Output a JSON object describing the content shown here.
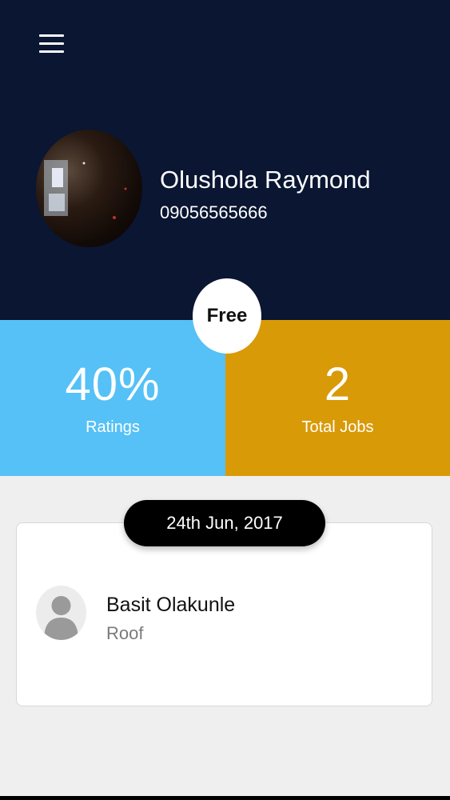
{
  "header": {
    "menu_icon": "menu-icon",
    "avatar_icon": "profile-photo"
  },
  "profile": {
    "name": "Olushola Raymond",
    "phone": "09056565666",
    "plan": "Free"
  },
  "stats": {
    "ratings": {
      "value": "40%",
      "label": "Ratings",
      "color": "#55c1f6"
    },
    "total_jobs": {
      "value": "2",
      "label": "Total Jobs",
      "color": "#d99a08"
    }
  },
  "jobs": [
    {
      "date": "24th Jun, 2017",
      "name": "Basit Olakunle",
      "category": "Roof",
      "avatar_icon": "person-silhouette-icon"
    }
  ],
  "colors": {
    "header_bg": "#0a1632",
    "background": "#efefef"
  }
}
